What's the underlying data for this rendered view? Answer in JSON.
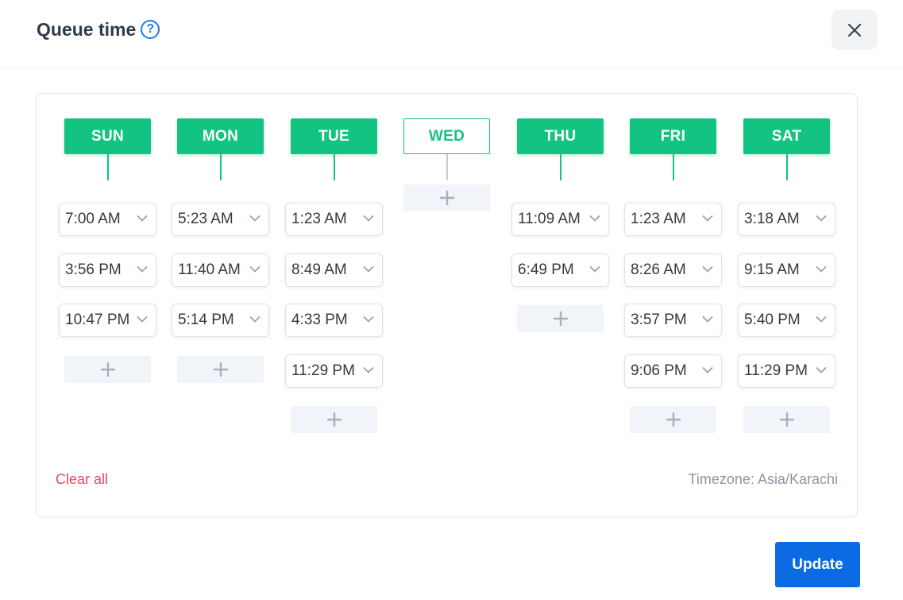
{
  "header": {
    "title": "Queue time",
    "help_icon": "?",
    "close_icon": "x-icon"
  },
  "days": [
    {
      "label": "SUN",
      "active": true,
      "times": [
        "7:00 AM",
        "3:56 PM",
        "10:47 PM"
      ]
    },
    {
      "label": "MON",
      "active": true,
      "times": [
        "5:23 AM",
        "11:40 AM",
        "5:14 PM"
      ]
    },
    {
      "label": "TUE",
      "active": true,
      "times": [
        "1:23 AM",
        "8:49 AM",
        "4:33 PM",
        "11:29 PM"
      ]
    },
    {
      "label": "WED",
      "active": false,
      "times": []
    },
    {
      "label": "THU",
      "active": true,
      "times": [
        "11:09 AM",
        "6:49 PM"
      ]
    },
    {
      "label": "FRI",
      "active": true,
      "times": [
        "1:23 AM",
        "8:26 AM",
        "3:57 PM",
        "9:06 PM"
      ]
    },
    {
      "label": "SAT",
      "active": true,
      "times": [
        "3:18 AM",
        "9:15 AM",
        "5:40 PM",
        "11:29 PM"
      ]
    }
  ],
  "footer": {
    "clear_all": "Clear all",
    "timezone": "Timezone: Asia/Karachi"
  },
  "actions": {
    "update_label": "Update"
  },
  "colors": {
    "accent_green": "#13c381",
    "primary_blue": "#0a6be3",
    "danger_red": "#f0455f"
  }
}
